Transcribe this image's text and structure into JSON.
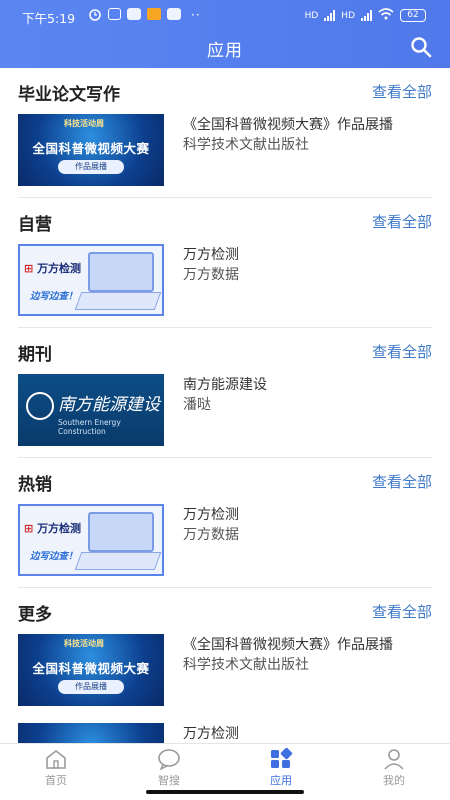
{
  "status": {
    "time": "下午5:19",
    "battery": "62",
    "signal1": "HD",
    "signal2": "HD"
  },
  "header": {
    "title": "应用"
  },
  "colors": {
    "accent": "#4f78ea",
    "link": "#3f79c7"
  },
  "sections": [
    {
      "title": "毕业论文写作",
      "more": "查看全部",
      "item": {
        "name": "《全国科普微视频大赛》作品展播",
        "sub": "科学技术文献出版社",
        "thumb_big": "全国科普微视频大赛",
        "thumb_small": "作品展播",
        "thumb_logo": "科技活动周"
      }
    },
    {
      "title": "自营",
      "more": "查看全部",
      "item": {
        "name": "万方检测",
        "sub": "万方数据",
        "thumb_brand": "万方检测",
        "thumb_tag": "边写边查！"
      }
    },
    {
      "title": "期刊",
      "more": "查看全部",
      "item": {
        "name": "南方能源建设",
        "sub": "潘哒",
        "thumb_cn": "南方能源建设",
        "thumb_en": "Southern Energy Construction"
      }
    },
    {
      "title": "热销",
      "more": "查看全部",
      "item": {
        "name": "万方检测",
        "sub": "万方数据",
        "thumb_brand": "万方检测",
        "thumb_tag": "边写边查！"
      }
    },
    {
      "title": "更多",
      "more": "查看全部",
      "item": {
        "name": "《全国科普微视频大赛》作品展播",
        "sub": "科学技术文献出版社",
        "thumb_big": "全国科普微视频大赛",
        "thumb_small": "作品展播",
        "thumb_logo": "科技活动周"
      }
    }
  ],
  "extra_item": {
    "name": "万方检测"
  },
  "tabs": [
    {
      "label": "首页",
      "icon": "home-icon",
      "active": false
    },
    {
      "label": "智搜",
      "icon": "chat-search-icon",
      "active": false
    },
    {
      "label": "应用",
      "icon": "apps-icon",
      "active": true
    },
    {
      "label": "我的",
      "icon": "user-icon",
      "active": false
    }
  ]
}
